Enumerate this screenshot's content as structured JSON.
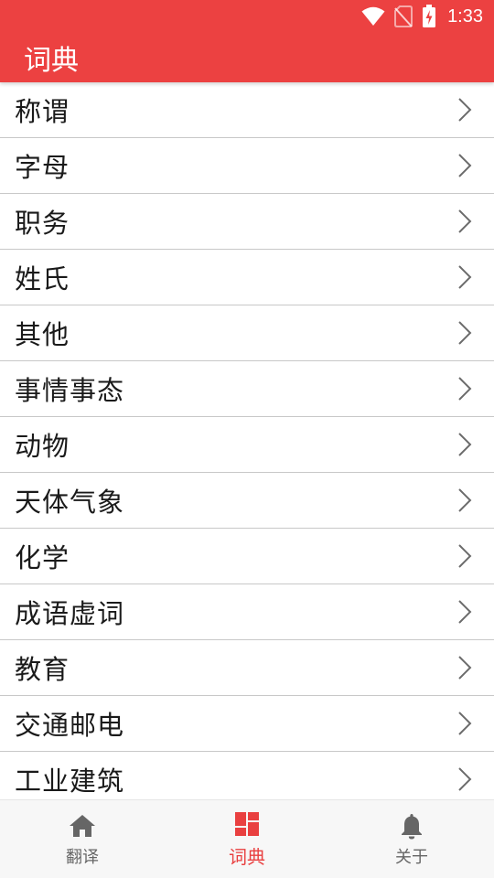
{
  "status_bar": {
    "time": "1:33",
    "icons": [
      "wifi-icon",
      "no-sim-icon",
      "battery-charging-icon"
    ]
  },
  "toolbar": {
    "title": "词典"
  },
  "colors": {
    "primary": "#EC4141",
    "active_tab": "#E94040",
    "inactive_tab": "#666666",
    "divider": "#C8C8C8"
  },
  "categories": [
    {
      "label": "称谓"
    },
    {
      "label": "字母"
    },
    {
      "label": "职务"
    },
    {
      "label": "姓氏"
    },
    {
      "label": "其他"
    },
    {
      "label": "事情事态"
    },
    {
      "label": "动物"
    },
    {
      "label": "天体气象"
    },
    {
      "label": "化学"
    },
    {
      "label": "成语虚词"
    },
    {
      "label": "教育"
    },
    {
      "label": "交通邮电"
    },
    {
      "label": "工业建筑"
    }
  ],
  "bottom_nav": {
    "tabs": [
      {
        "label": "翻译",
        "icon": "home-icon",
        "active": false
      },
      {
        "label": "词典",
        "icon": "dashboard-icon",
        "active": true
      },
      {
        "label": "关于",
        "icon": "bell-icon",
        "active": false
      }
    ]
  }
}
